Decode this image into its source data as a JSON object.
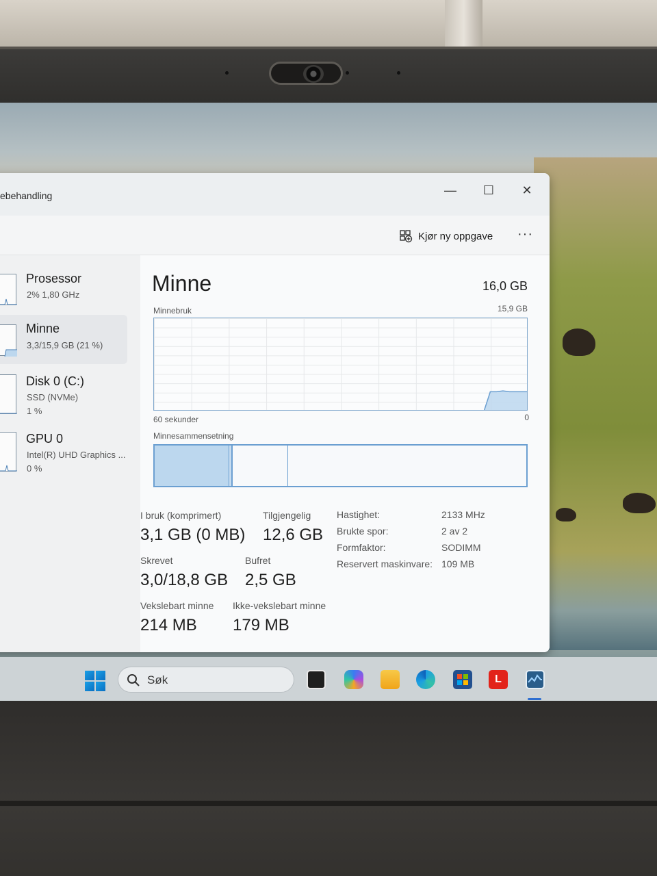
{
  "window": {
    "title": "ebehandling",
    "minimize_glyph": "—",
    "maximize_glyph": "☐",
    "close_glyph": "✕"
  },
  "toolbar": {
    "run_new_task": "Kjør ny oppgave",
    "more": "···"
  },
  "sidebar": {
    "items": [
      {
        "name": "Prosessor",
        "line1": "2%  1,80 GHz",
        "line2": ""
      },
      {
        "name": "Minne",
        "line1": "3,3/15,9 GB (21 %)",
        "line2": ""
      },
      {
        "name": "Disk 0 (C:)",
        "line1": "SSD (NVMe)",
        "line2": "1 %"
      },
      {
        "name": "GPU 0",
        "line1": "Intel(R) UHD Graphics ...",
        "line2": "0 %"
      }
    ]
  },
  "memory": {
    "title": "Minne",
    "total": "16,0 GB",
    "graph_label": "Minnebruk",
    "graph_max": "15,9 GB",
    "graph_time": "60 sekunder",
    "graph_zero": "0",
    "usage_fraction_history": [
      0,
      0,
      0,
      0,
      0,
      0,
      0,
      0,
      0,
      0,
      0,
      0,
      0,
      0,
      0,
      0,
      0,
      0,
      0,
      0,
      0,
      0,
      0,
      0,
      0,
      0,
      0,
      0,
      0,
      0,
      0,
      0,
      0,
      0,
      0,
      0,
      0,
      0,
      0,
      0,
      0,
      0,
      0,
      0,
      0,
      0,
      0,
      0,
      0,
      0,
      0,
      0,
      0,
      0.21,
      0.21,
      0.22,
      0.21,
      0.21,
      0.21,
      0.21
    ],
    "composition_label": "Minnesammensetning",
    "composition": {
      "in_use_pct": 20,
      "modified_pct": 1,
      "standby_pct": 15,
      "free_pct": 64
    }
  },
  "stats": {
    "in_use_label": "I bruk (komprimert)",
    "in_use_value": "3,1 GB (0 MB)",
    "available_label": "Tilgjengelig",
    "available_value": "12,6 GB",
    "committed_label": "Skrevet",
    "committed_value": "3,0/18,8 GB",
    "cached_label": "Bufret",
    "cached_value": "2,5 GB",
    "paged_label": "Vekslebart minne",
    "paged_value": "214 MB",
    "nonpaged_label": "Ikke-vekslebart minne",
    "nonpaged_value": "179 MB",
    "speed_label": "Hastighet:",
    "speed_value": "2133 MHz",
    "slots_label": "Brukte spor:",
    "slots_value": "2 av 2",
    "form_label": "Formfaktor:",
    "form_value": "SODIMM",
    "reserved_label": "Reservert maskinvare:",
    "reserved_value": "109 MB"
  },
  "taskbar": {
    "search_placeholder": "Søk",
    "icons": [
      "windows-start-icon",
      "task-view-icon",
      "copilot-icon",
      "file-explorer-icon",
      "edge-icon",
      "store-icon",
      "lenovo-icon",
      "task-manager-icon"
    ],
    "lenovo_glyph": "L"
  },
  "colors": {
    "accent": "#6b9fd1",
    "graph_fill": "#bcd7ee"
  }
}
